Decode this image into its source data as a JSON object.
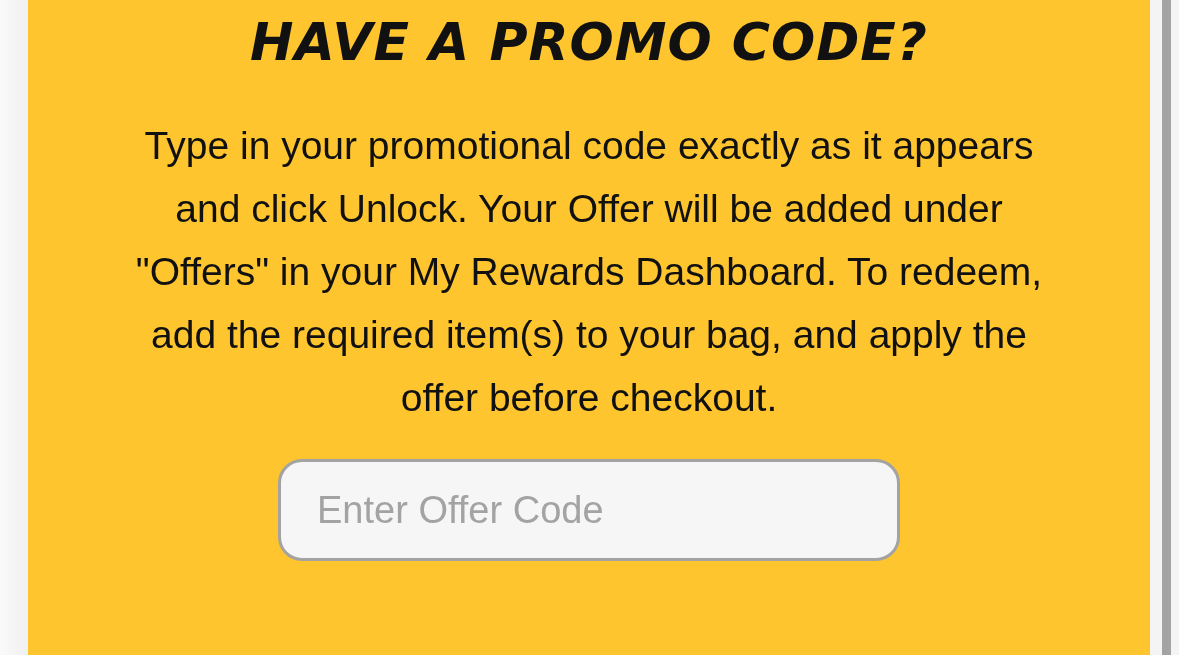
{
  "promo": {
    "title": "HAVE A PROMO CODE?",
    "description": "Type in your promotional code exactly as it appears and click Unlock. Your Offer will be added under \"Offers\" in your My Rewards Dashboard. To redeem, add the required item(s) to your bag, and apply the offer before checkout.",
    "code_field": {
      "placeholder": "Enter Offer Code"
    }
  }
}
